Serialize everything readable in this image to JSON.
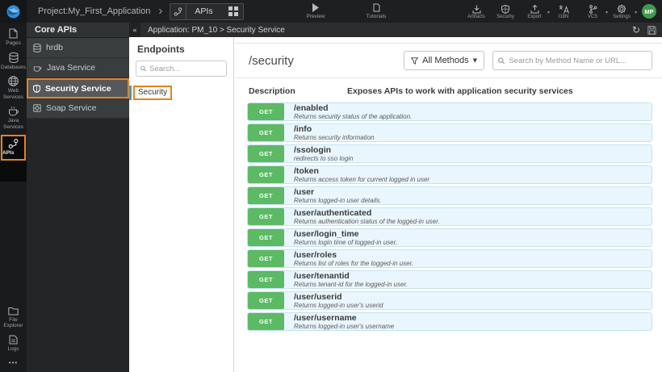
{
  "topbar": {
    "project_label": "Project:My_First_Application",
    "tab": {
      "label": "APIs"
    },
    "preview_label": "Preview",
    "tutorials_label": "Tutorials",
    "right_items": {
      "artifacts": "Artifacts",
      "security": "Security",
      "export": "Export",
      "i18n": "I18N",
      "vcs": "VCS",
      "settings": "Settings"
    },
    "avatar_initials": "MP"
  },
  "rail": {
    "pages": "Pages",
    "databases": "Databases",
    "web_services": "Web Services",
    "java_services": "Java Services",
    "apis": "APIs",
    "file_explorer": "File Explorer",
    "logs": "Logs",
    "more": "•••"
  },
  "core_apis": {
    "title": "Core APIs",
    "items": {
      "hrdb": "hrdb",
      "java_service": "Java Service",
      "security_service": "Security Service",
      "soap_service": "Soap Service"
    }
  },
  "app_header": {
    "collapse_glyph": "«",
    "title": "Application: PM_10 > Security Service"
  },
  "endpoints_panel": {
    "title": "Endpoints",
    "search_placeholder": "Search...",
    "selected_item": "Security"
  },
  "main": {
    "title": "/security",
    "methods_filter_label": "All Methods",
    "search_placeholder": "Search by Method Name or URL...",
    "description_label": "Description",
    "description_value": "Exposes APIs to work with application security services",
    "endpoints": [
      {
        "method": "GET",
        "path": "/enabled",
        "desc": "Returns security status of the application."
      },
      {
        "method": "GET",
        "path": "/info",
        "desc": "Returns security information"
      },
      {
        "method": "GET",
        "path": "/ssologin",
        "desc": "redirects to sso login"
      },
      {
        "method": "GET",
        "path": "/token",
        "desc": "Returns access token for current logged in user"
      },
      {
        "method": "GET",
        "path": "/user",
        "desc": "Returns logged-in user details."
      },
      {
        "method": "GET",
        "path": "/user/authenticated",
        "desc": "Returns authentication status of the logged-in user."
      },
      {
        "method": "GET",
        "path": "/user/login_time",
        "desc": "Returns login time of logged-in user."
      },
      {
        "method": "GET",
        "path": "/user/roles",
        "desc": "Returns list of roles for the logged-in user."
      },
      {
        "method": "GET",
        "path": "/user/tenantid",
        "desc": "Returns tenant-id for the logged-in user."
      },
      {
        "method": "GET",
        "path": "/user/userid",
        "desc": "Returns logged-in user's userid"
      },
      {
        "method": "GET",
        "path": "/user/username",
        "desc": "Returns logged-in user's username"
      }
    ]
  },
  "colors": {
    "accent_orange": "#E8821E",
    "method_get_green": "#5CB964",
    "endpoint_row_bg": "#E9F6FD",
    "endpoint_row_border": "#C3E3F3",
    "selected_endpoint_bar_blue": "#2F9FD8",
    "avatar_green": "#3F9A4D",
    "logo_blue": "#2D8FE2",
    "topbar_bg": "#1D1F21"
  }
}
